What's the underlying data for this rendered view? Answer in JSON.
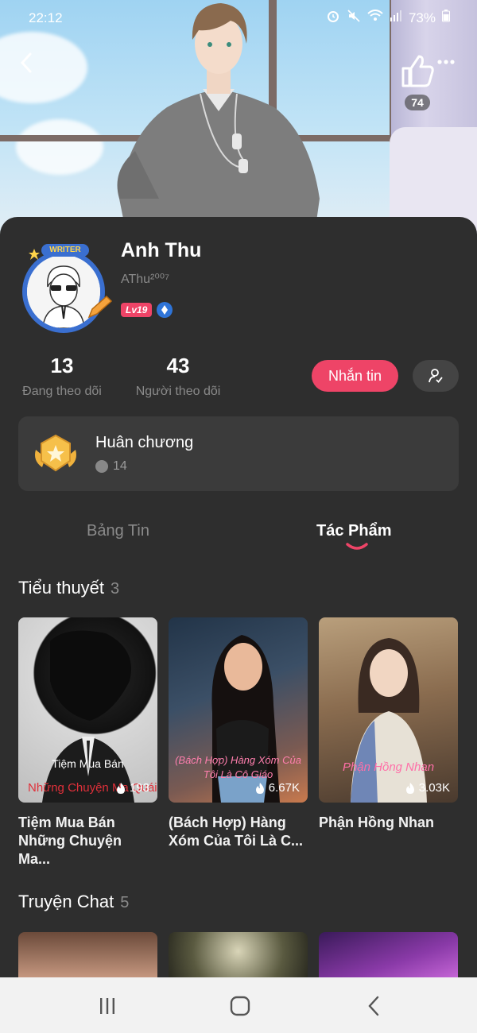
{
  "status_bar": {
    "time": "22:12",
    "battery": "73%",
    "icons": [
      "alarm-icon",
      "mute-icon",
      "wifi-icon",
      "signal-icon",
      "battery-icon"
    ]
  },
  "header": {
    "like_count": "74"
  },
  "profile": {
    "name": "Anh Thu",
    "handle": "AThu²⁰⁰⁷",
    "avatar_badge": "WRITER",
    "level": "Lv19",
    "following_count": "13",
    "following_label": "Đang theo dõi",
    "followers_count": "43",
    "followers_label": "Người theo dõi",
    "message_button": "Nhắn tin"
  },
  "medals": {
    "title": "Huân chương",
    "count": "14"
  },
  "tabs": [
    {
      "label": "Bảng Tin",
      "active": false
    },
    {
      "label": "Tác Phẩm",
      "active": true
    }
  ],
  "novels": {
    "title": "Tiểu thuyết",
    "count": "3",
    "items": [
      {
        "title": "Tiệm Mua Bán Những Chuyện Ma...",
        "cover_line1": "Tiệm Mua Bán",
        "cover_line2": "Những Chuyện Ma Quái",
        "views": "193"
      },
      {
        "title": "(Bách Hợp) Hàng Xóm Của Tôi Là C...",
        "cover_line1": "(Bách Hợp) Hàng Xóm Của",
        "cover_line2": "Tôi Là Cô Giáo",
        "views": "6.67K"
      },
      {
        "title": "Phận Hồng Nhan",
        "cover_line1": "Phận Hồng Nhan",
        "cover_line2": "",
        "views": "3.03K"
      }
    ]
  },
  "chat_stories": {
    "title": "Truyện Chat",
    "count": "5"
  },
  "colors": {
    "accent": "#ee4467",
    "sheet_bg": "#2e2e2e",
    "card_bg": "#3b3b3b",
    "muted_text": "#8a8a8a"
  }
}
